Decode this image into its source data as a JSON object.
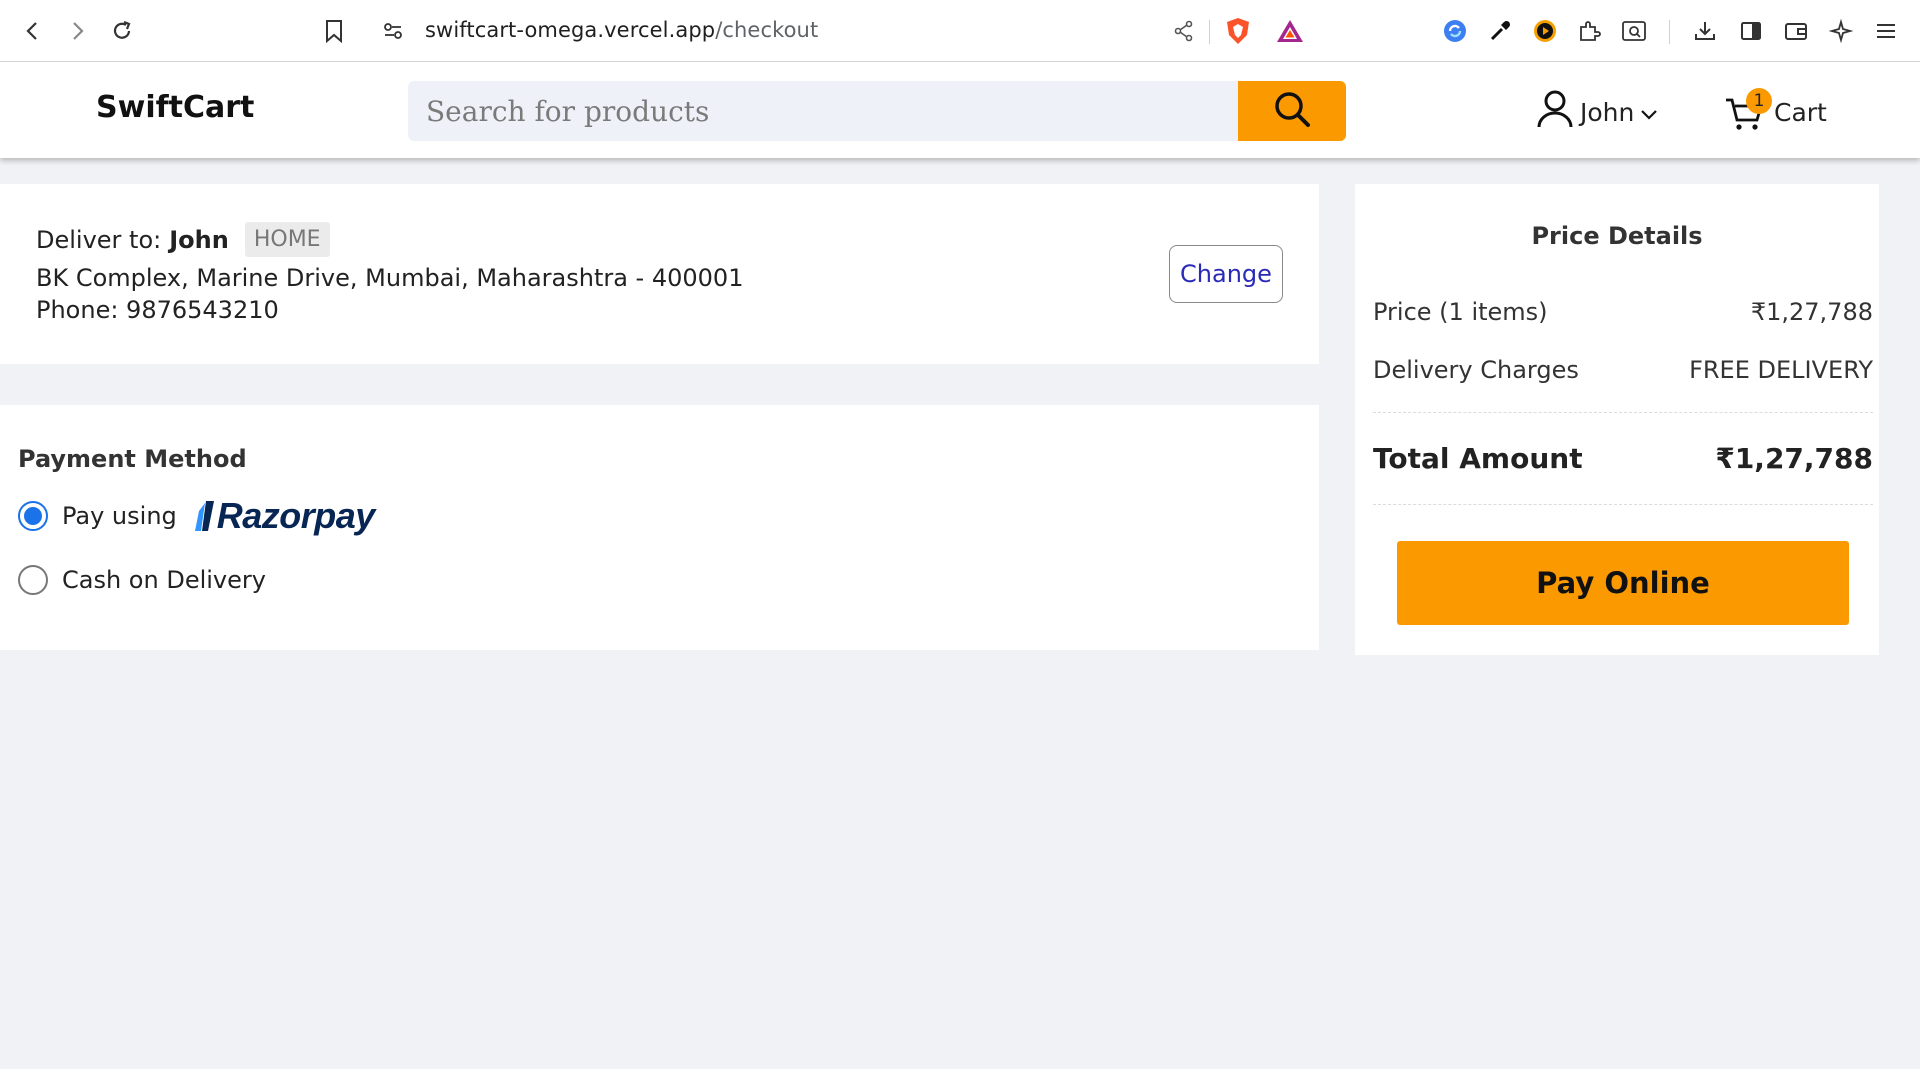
{
  "browser": {
    "url_domain": "swiftcart-omega.vercel.app",
    "url_path": "/checkout"
  },
  "header": {
    "logo": "SwiftCart",
    "search_placeholder": "Search for products",
    "user_name": "John",
    "cart_label": "Cart",
    "cart_count": "1"
  },
  "address": {
    "deliver_to_label": "Deliver to:",
    "name": "John",
    "tag": "HOME",
    "full_address": "BK Complex, Marine Drive, Mumbai, Maharashtra - 400001",
    "phone": "Phone: 9876543210",
    "change_label": "Change"
  },
  "payment": {
    "title": "Payment Method",
    "options": [
      {
        "label": "Pay using",
        "brand": "Razorpay",
        "selected": true
      },
      {
        "label": "Cash on Delivery",
        "selected": false
      }
    ]
  },
  "price_details": {
    "title": "Price Details",
    "price_label": "Price (1 items)",
    "price_value": "₹1,27,788",
    "delivery_label": "Delivery Charges",
    "delivery_value": "FREE DELIVERY",
    "total_label": "Total Amount",
    "total_value": "₹1,27,788",
    "pay_button": "Pay Online"
  },
  "colors": {
    "accent": "#fb9a00",
    "radio": "#1a73e8",
    "razorpay": "#072654"
  }
}
